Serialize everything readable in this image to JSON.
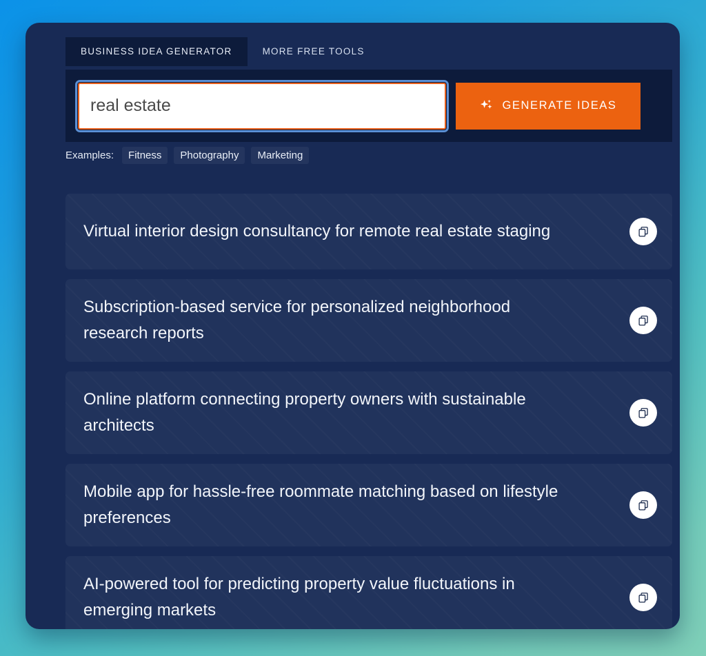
{
  "theme": {
    "panel_bg": "#182a55",
    "accent_orange": "#ec6210",
    "focus_blue": "#5b8fd4",
    "card_text": "#f2f5fa",
    "page_gradient_start": "#0b92e8",
    "page_gradient_end": "#7fcfb8"
  },
  "tabs": [
    {
      "label": "BUSINESS IDEA GENERATOR",
      "active": true
    },
    {
      "label": "MORE FREE TOOLS",
      "active": false
    }
  ],
  "search": {
    "value": "real estate",
    "placeholder": "",
    "generate_label": "GENERATE IDEAS",
    "generate_icon": "sparkle-icon"
  },
  "examples": {
    "label": "Examples:",
    "items": [
      "Fitness",
      "Photography",
      "Marketing"
    ]
  },
  "results": {
    "copy_icon": "copy-icon",
    "items": [
      {
        "text": "Virtual interior design consultancy for remote real estate staging"
      },
      {
        "text": "Subscription-based service for personalized neighborhood research reports"
      },
      {
        "text": "Online platform connecting property owners with sustainable architects"
      },
      {
        "text": "Mobile app for hassle-free roommate matching based on lifestyle preferences"
      },
      {
        "text": "AI-powered tool for predicting property value fluctuations in emerging markets"
      }
    ]
  }
}
